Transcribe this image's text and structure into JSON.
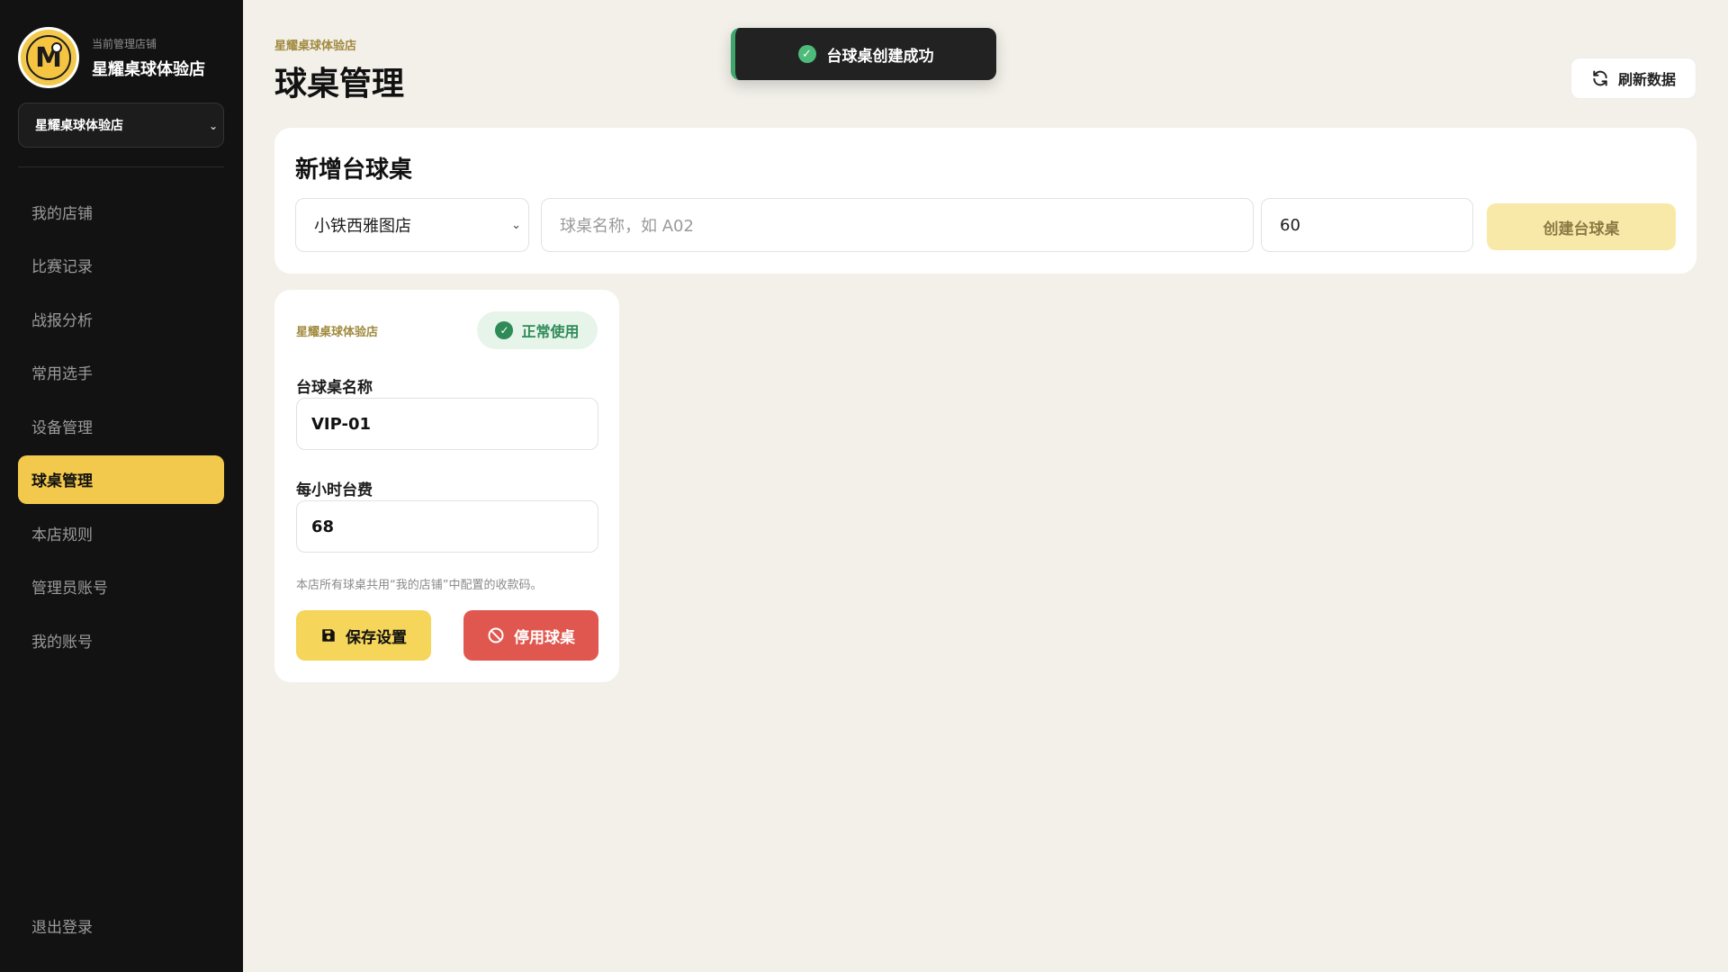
{
  "sidebar": {
    "brand_subtitle": "当前管理店铺",
    "brand_name": "星耀桌球体验店",
    "logo_letter": "M",
    "store_select_value": "星耀桌球体验店",
    "nav": [
      {
        "label": "我的店铺",
        "active": false
      },
      {
        "label": "比赛记录",
        "active": false
      },
      {
        "label": "战报分析",
        "active": false
      },
      {
        "label": "常用选手",
        "active": false
      },
      {
        "label": "设备管理",
        "active": false
      },
      {
        "label": "球桌管理",
        "active": true
      },
      {
        "label": "本店规则",
        "active": false
      },
      {
        "label": "管理员账号",
        "active": false
      },
      {
        "label": "我的账号",
        "active": false
      }
    ],
    "logout_label": "退出登录"
  },
  "header": {
    "breadcrumb": "星耀桌球体验店",
    "title": "球桌管理",
    "refresh_label": "刷新数据"
  },
  "toast": {
    "message": "台球桌创建成功"
  },
  "new_table": {
    "title": "新增台球桌",
    "store_select_value": "小铁西雅图店",
    "name_placeholder": "球桌名称，如 A02",
    "price_value": "60",
    "create_label": "创建台球桌"
  },
  "table_card": {
    "store_name": "星耀桌球体验店",
    "status_label": "正常使用",
    "name_label": "台球桌名称",
    "name_value": "VIP-01",
    "price_label": "每小时台费",
    "price_value": "68",
    "hint": "本店所有球桌共用“我的店铺”中配置的收款码。",
    "save_label": "保存设置",
    "disable_label": "停用球桌"
  },
  "colors": {
    "sidebar_bg": "#121212",
    "accent": "#f2c94c",
    "danger": "#e0574f",
    "success": "#2e8b57",
    "page_bg": "#f3f0ea"
  },
  "icons": [
    "refresh-icon",
    "check-circle-icon",
    "save-icon",
    "ban-icon",
    "chevron-down-icon"
  ]
}
